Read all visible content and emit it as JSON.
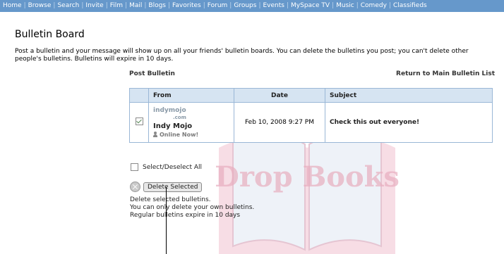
{
  "nav": {
    "items": [
      "Home",
      "Browse",
      "Search",
      "Invite",
      "Film",
      "Mail",
      "Blogs",
      "Favorites",
      "Forum",
      "Groups",
      "Events",
      "MySpace TV",
      "Music",
      "Comedy",
      "Classifieds"
    ]
  },
  "page": {
    "title": "Bulletin Board",
    "intro": "Post a bulletin and your message will show up on all your friends' bulletin boards. You can delete the bulletins you post; you can't delete other people's bulletins. Bulletins will expire in 10 days.",
    "post_link": "Post Bulletin",
    "return_link": "Return to Main Bulletin List"
  },
  "table": {
    "headers": {
      "from": "From",
      "date": "Date",
      "subject": "Subject"
    },
    "rows": [
      {
        "checked": true,
        "sender_logo": "indymojo",
        "sender_logo_suffix": ".com",
        "sender_name": "Indy Mojo",
        "status": "Online Now!",
        "date": "Feb 10, 2008 9:27 PM",
        "subject": "Check this out everyone!"
      }
    ]
  },
  "controls": {
    "select_all_label": "Select/Deselect All",
    "delete_label": "Delete Selected"
  },
  "help": {
    "line1": "Delete selected bulletins.",
    "line2": "You can only delete your own bulletins.",
    "line3": "Regular bulletins expire in 10 days"
  },
  "watermark_text": "Drop Books",
  "colors": {
    "nav_bg": "#6698cb",
    "table_header_bg": "#d6e4f2",
    "table_border": "#9ab7d6",
    "watermark": "#e8aebf"
  }
}
